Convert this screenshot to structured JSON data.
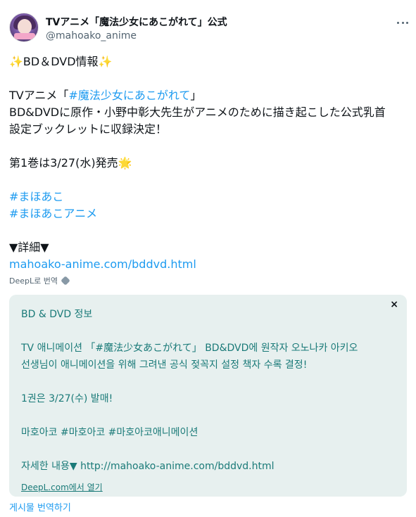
{
  "account": {
    "display_name": "TVアニメ「魔法少女にあこがれて」公式",
    "handle": "@mahoako_anime",
    "avatar_icon": "avatar-image"
  },
  "post": {
    "sparkle": "✨",
    "header_text": "BD＆DVD情報",
    "anime_prefix": "TVアニメ「",
    "anime_link": "#魔法少女にあこがれて",
    "anime_suffix": "」",
    "bd_line1": "BD&DVDに原作・小野中彰大先生がアニメのために描き起こした公式乳首",
    "bd_line2": "設定ブックレットに収録決定！",
    "release_text": "第1巻は3/27(水)発売",
    "star": "🌟",
    "hashtag1": "#まほあこ",
    "hashtag2": "#まほあこアニメ",
    "details_label": "▼詳細▼",
    "url": "mahoako-anime.com/bddvd.html",
    "deepl_label": "DeepL로 번역"
  },
  "translation": {
    "close_icon": "×",
    "line1": "BD & DVD 정보",
    "line2": "TV 애니메이션 「#魔法少女あこがれて」 BD&DVD에 원작자 오노나카 아키오",
    "line3": "선생님이 애니메이션을 위해 그려낸 공식 젖꼭지 설정 책자 수록 결정!",
    "line4": "1권은 3/27(수) 발매!",
    "line5": "마호아코 #마호아코 #마호아코애니메이션",
    "line6": "자세한 내용▼ http://mahoako-anime.com/bddvd.html",
    "footer": "DeepL.com에서 열기"
  },
  "actions": {
    "translate_post": "게시물 번역하기"
  }
}
